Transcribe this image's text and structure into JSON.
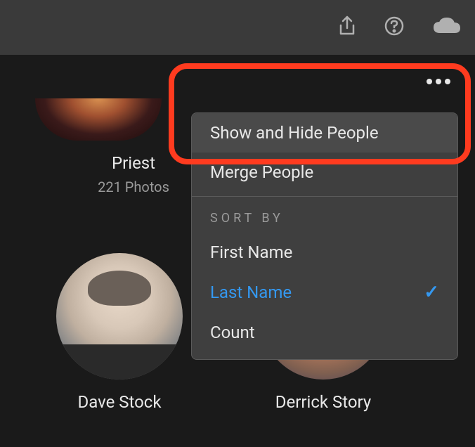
{
  "people": [
    {
      "name": "Priest",
      "count_label": "221 Photos"
    },
    {
      "name": "Dave Stock",
      "count_label": ""
    },
    {
      "name": "Derrick Story",
      "count_label": ""
    }
  ],
  "dropdown": {
    "show_hide_label": "Show and Hide People",
    "merge_label": "Merge People",
    "sort_by_header": "SORT BY",
    "sort_first_name": "First Name",
    "sort_last_name": "Last Name",
    "sort_count": "Count",
    "selected_sort": "Last Name"
  },
  "colors": {
    "highlight": "#ff3b1f",
    "selected": "#3498f0",
    "bg": "#1a1a1a",
    "panel": "#3f3f3f"
  }
}
